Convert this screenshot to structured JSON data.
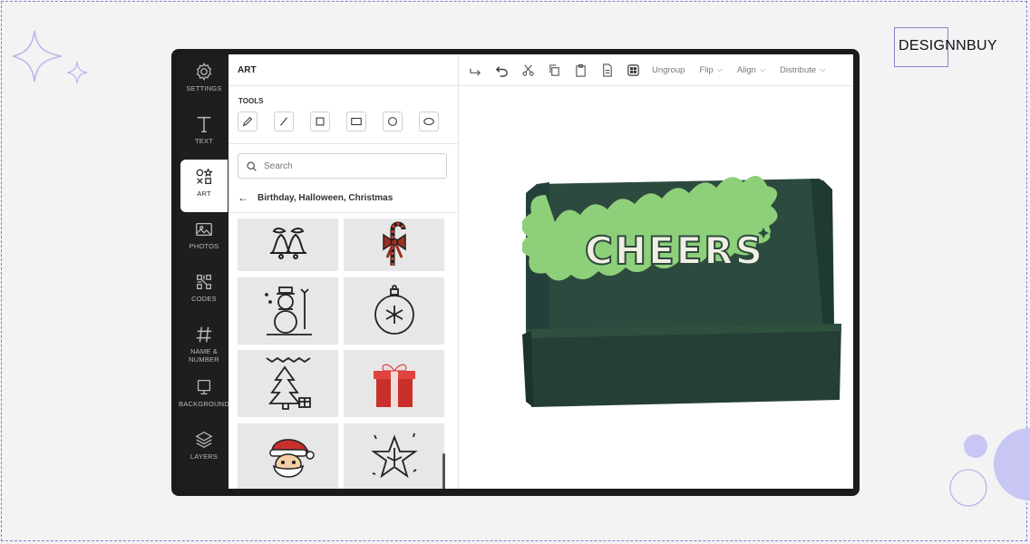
{
  "brand": {
    "name": "DESIGNNBUY"
  },
  "sidebar": {
    "items": [
      {
        "label": "SETTINGS",
        "icon": "gear-icon",
        "active": false
      },
      {
        "label": "TEXT",
        "icon": "text-icon",
        "active": false
      },
      {
        "label": "ART",
        "icon": "shapes-icon",
        "active": true
      },
      {
        "label": "PHOTOS",
        "icon": "image-icon",
        "active": false
      },
      {
        "label": "CODES",
        "icon": "qr-code-icon",
        "active": false
      },
      {
        "label": "NAME & NUMBER",
        "icon": "hashtag-icon",
        "active": false
      },
      {
        "label": "BACKGROUND",
        "icon": "background-icon",
        "active": false
      },
      {
        "label": "LAYERS",
        "icon": "layers-icon",
        "active": false
      }
    ]
  },
  "panel": {
    "title": "ART",
    "tools_label": "TOOLS",
    "tools": [
      "pencil-tool",
      "line-tool",
      "square-tool",
      "rectangle-tool",
      "circle-tool",
      "ellipse-tool"
    ],
    "search_placeholder": "Search",
    "breadcrumb": "Birthday, Halloween, Christmas",
    "art_items": [
      "bells-icon",
      "candy-cane-bow-icon",
      "snowman-icon",
      "ornament-icon",
      "christmas-tree-icon",
      "gift-box-icon",
      "santa-icon",
      "star-icon"
    ]
  },
  "toolbar": {
    "icons": [
      "redo-icon",
      "undo-icon",
      "cut-icon",
      "copy-icon",
      "paste-icon",
      "duplicate-icon",
      "pattern-icon"
    ],
    "ungroup_label": "Ungroup",
    "flip_label": "Flip",
    "align_label": "Align",
    "distribute_label": "Distribute"
  },
  "canvas": {
    "product": "mailer-box",
    "design_text": "CHEERS",
    "colors": {
      "box": "#2c4a3e",
      "badge": "#8ed07a",
      "letters": "#f2efe2"
    }
  }
}
